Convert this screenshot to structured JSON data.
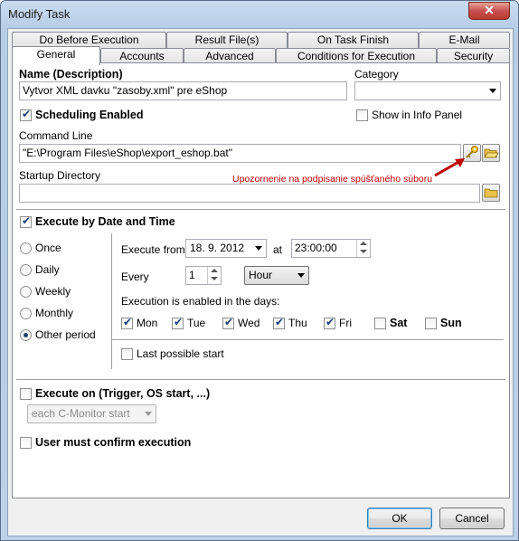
{
  "window": {
    "title": "Modify Task",
    "close_glyph": "✕"
  },
  "tabs": {
    "row1": [
      "Do Before Execution",
      "Result File(s)",
      "On Task Finish",
      "E-Mail"
    ],
    "row2": [
      "General",
      "Accounts",
      "Advanced",
      "Conditions for Execution",
      "Security"
    ],
    "active": "General"
  },
  "general": {
    "name_label": "Name (Description)",
    "name_value": "Vytvor XML davku \"zasoby.xml\" pre eShop",
    "category_label": "Category",
    "category_value": "",
    "scheduling_label": "Scheduling Enabled",
    "scheduling_checked": true,
    "show_info_label": "Show in Info Panel",
    "show_info_checked": false,
    "command_label": "Command Line",
    "command_value": "\"E:\\Program Files\\eShop\\export_eshop.bat\"",
    "annotation": "Upozornenie na podpisanie spúšťaného súboru",
    "annotation_color": "#c00000",
    "startup_label": "Startup Directory",
    "startup_value": ""
  },
  "schedule": {
    "execute_by_date_label": "Execute by Date and Time",
    "execute_by_date_checked": true,
    "periods": [
      "Once",
      "Daily",
      "Weekly",
      "Monthly",
      "Other period"
    ],
    "selected_period": "Other period",
    "execute_from_label": "Execute from",
    "date_value": "18.  9. 2012",
    "at_label": "at",
    "time_value": "23:00:00",
    "every_label": "Every",
    "every_value": "1",
    "unit_value": "Hour",
    "days_label": "Execution is enabled in the days:",
    "days": [
      {
        "label": "Mon",
        "checked": true,
        "bold": false
      },
      {
        "label": "Tue",
        "checked": true,
        "bold": false
      },
      {
        "label": "Wed",
        "checked": true,
        "bold": false
      },
      {
        "label": "Thu",
        "checked": true,
        "bold": false
      },
      {
        "label": "Fri",
        "checked": true,
        "bold": false
      },
      {
        "label": "Sat",
        "checked": false,
        "bold": true
      },
      {
        "label": "Sun",
        "checked": false,
        "bold": true
      }
    ],
    "last_possible_label": "Last possible start",
    "last_possible_checked": false
  },
  "trigger": {
    "execute_on_label": "Execute on (Trigger, OS start, ...)",
    "execute_on_checked": false,
    "trigger_value": "each C-Monitor start",
    "confirm_label": "User must confirm execution",
    "confirm_checked": false
  },
  "buttons": {
    "ok": "OK",
    "cancel": "Cancel"
  }
}
